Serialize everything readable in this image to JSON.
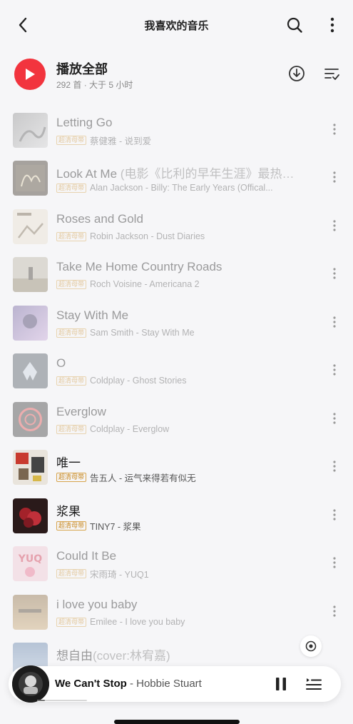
{
  "header": {
    "title": "我喜欢的音乐"
  },
  "playall": {
    "title": "播放全部",
    "subtitle": "292 首 · 大于 5 小时"
  },
  "badge_label": "超清母带",
  "songs": [
    {
      "title": "Letting Go",
      "subtitle": "",
      "meta": "蔡健雅 - 说到爱",
      "dim": true
    },
    {
      "title": "Look At Me ",
      "subtitle": "(电影《比利的早年生涯》最热…",
      "meta": "Alan Jackson - Billy: The Early Years (Offical...",
      "dim": true
    },
    {
      "title": "Roses and Gold",
      "subtitle": "",
      "meta": "Robin Jackson - Dust Diaries",
      "dim": true
    },
    {
      "title": "Take Me Home Country Roads",
      "subtitle": "",
      "meta": "Roch Voisine - Americana 2",
      "dim": true
    },
    {
      "title": "Stay With Me",
      "subtitle": "",
      "meta": "Sam Smith - Stay With Me",
      "dim": true
    },
    {
      "title": "O",
      "subtitle": "",
      "meta": "Coldplay - Ghost Stories",
      "dim": true
    },
    {
      "title": "Everglow",
      "subtitle": "",
      "meta": "Coldplay - Everglow",
      "dim": true
    },
    {
      "title": "唯一",
      "subtitle": "",
      "meta": "告五人 - 运气来得若有似无",
      "dim": false
    },
    {
      "title": "浆果",
      "subtitle": "",
      "meta": "TINY7 - 浆果",
      "dim": false
    },
    {
      "title": "Could It Be",
      "subtitle": "",
      "meta": "宋雨琦 - YUQ1",
      "dim": true
    },
    {
      "title": "i love you baby",
      "subtitle": "",
      "meta": "Emilee - I love you baby",
      "dim": true
    },
    {
      "title": "想自由",
      "subtitle": "(cover:林宥嘉)",
      "meta": "",
      "dim": true
    }
  ],
  "player": {
    "title": "We Can't Stop",
    "artist": " - Hobbie Stuart",
    "progress": 0.15
  },
  "colors": {
    "accent": "#f2343e",
    "badge": "#c98a22",
    "background": "#f6f6f8"
  }
}
